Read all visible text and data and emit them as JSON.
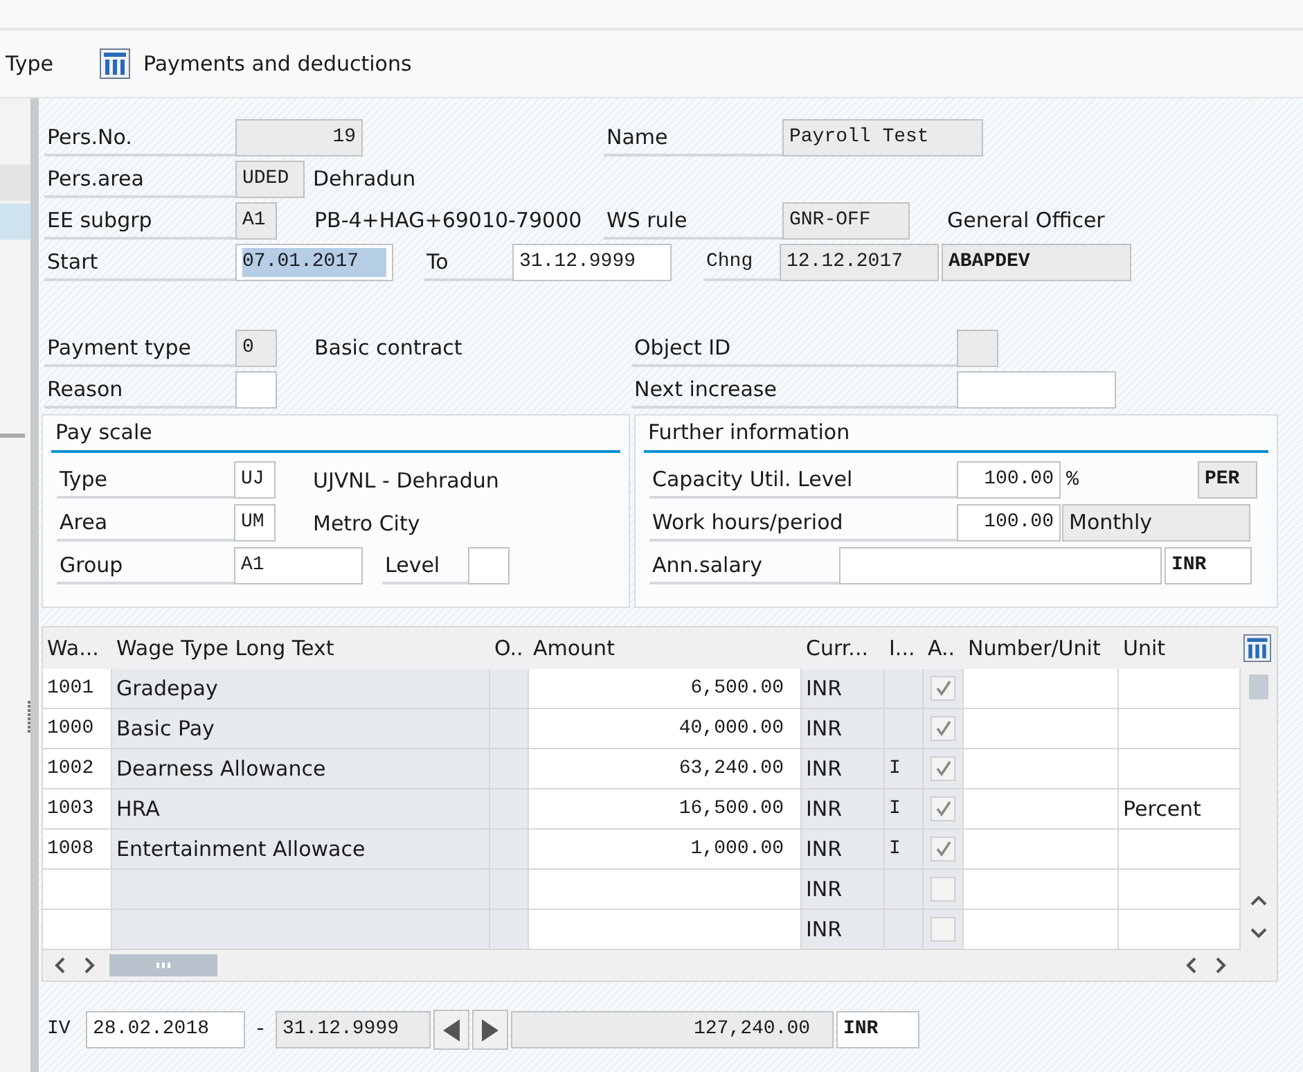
{
  "toolbar": {
    "cut_tab": "Type",
    "button": "Payments and deductions"
  },
  "header": {
    "pers_no": {
      "label": "Pers.No.",
      "value": "19"
    },
    "name": {
      "label": "Name",
      "value": "Payroll Test"
    },
    "pers_area": {
      "label": "Pers.area",
      "code": "UDED",
      "text": "Dehradun"
    },
    "ee_subgrp": {
      "label": "EE subgrp",
      "code": "A1",
      "text": "PB-4+HAG+69010-79000"
    },
    "ws_rule": {
      "label": "WS rule",
      "code": "GNR-OFF",
      "text": "General Officer"
    },
    "start": {
      "label": "Start",
      "value": "07.01.2017",
      "selected": true
    },
    "to": {
      "label": "To",
      "value": "31.12.9999"
    },
    "chng": {
      "label": "Chng",
      "date": "12.12.2017",
      "user": "ABAPDEV"
    }
  },
  "payment": {
    "payment_type": {
      "label": "Payment type",
      "code": "0",
      "text": "Basic contract"
    },
    "reason": {
      "label": "Reason"
    },
    "object_id": {
      "label": "Object ID"
    },
    "next_increase": {
      "label": "Next increase"
    }
  },
  "pay_scale": {
    "title": "Pay scale",
    "type": {
      "label": "Type",
      "code": "UJ",
      "text": "UJVNL - Dehradun"
    },
    "area": {
      "label": "Area",
      "code": "UM",
      "text": "Metro City"
    },
    "group": {
      "label": "Group",
      "code": "A1"
    },
    "level": {
      "label": "Level"
    }
  },
  "further_information": {
    "title": "Further information",
    "capacity": {
      "label": "Capacity Util. Level",
      "value": "100.00",
      "unit": "%",
      "code": "PER"
    },
    "work_hours": {
      "label": "Work hours/period",
      "value": "100.00",
      "unit": "Monthly"
    },
    "ann_salary": {
      "label": "Ann.salary",
      "currency": "INR"
    }
  },
  "table": {
    "columns": [
      "Wa...",
      "Wage Type Long Text",
      "O..",
      "Amount",
      "Curr...",
      "I...",
      "A..",
      "Number/Unit",
      "Unit"
    ],
    "rows": [
      {
        "wage_type": "1001",
        "long_text": "Gradepay",
        "amount": "6,500.00",
        "currency": "INR",
        "checked": true
      },
      {
        "wage_type": "1000",
        "long_text": "Basic Pay",
        "amount": "40,000.00",
        "currency": "INR",
        "checked": true
      },
      {
        "wage_type": "1002",
        "long_text": "Dearness Allowance",
        "amount": "63,240.00",
        "currency": "INR",
        "i": "I",
        "checked": true
      },
      {
        "wage_type": "1003",
        "long_text": "HRA",
        "amount": "16,500.00",
        "currency": "INR",
        "i": "I",
        "checked": true,
        "unit": "Percent"
      },
      {
        "wage_type": "1008",
        "long_text": "Entertainment Allowace",
        "amount": "1,000.00",
        "currency": "INR",
        "i": "I",
        "checked": true
      },
      {
        "currency": "INR",
        "checked": false
      },
      {
        "currency": "INR",
        "checked": false
      }
    ]
  },
  "footer": {
    "label": "IV",
    "from": "28.02.2018",
    "separator": "-",
    "to": "31.12.9999",
    "total": "127,240.00",
    "currency": "INR"
  }
}
